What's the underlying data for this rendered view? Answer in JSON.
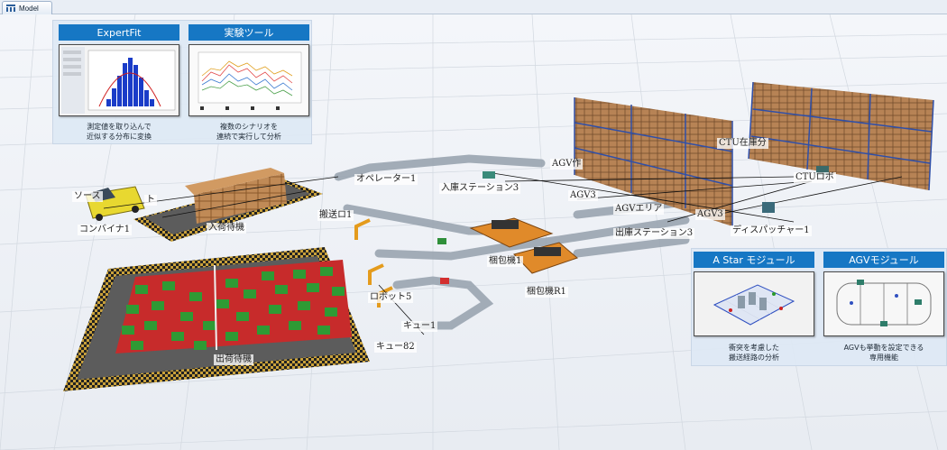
{
  "tab": {
    "label": "Model",
    "icon": "model-tree-icon"
  },
  "panels": {
    "expertfit": {
      "title": "ExpertFit",
      "caption": "測定値を取り込んで\n近似する分布に変換"
    },
    "experiment": {
      "title": "実験ツール",
      "caption": "複数のシナリオを\n連続で実行して分析"
    },
    "astar": {
      "title": "A Star モジュール",
      "caption": "衝突を考慮した\n搬送経路の分析"
    },
    "agv": {
      "title": "AGVモジュール",
      "caption": "AGVも挙動を設定できる\n専用機能"
    }
  },
  "labels": {
    "source": "ソース",
    "source_suffix": "ト",
    "combiner": "コンバイナ1",
    "inbound_wait": "入荷待機",
    "operator": "オペレーター1",
    "receiving_station": "入庫ステーション3",
    "agv_top": "AGV作",
    "agv3": "AGV3",
    "ctu_storage": "CTU在庫分",
    "ctu_robot": "CTUロボ",
    "agv_mid": "AGVエリア",
    "agv3_right": "AGV3",
    "dispatcher": "ディスパッチャー1",
    "shipping_station": "出庫ステーション3",
    "packer1": "梱包機1",
    "packer_r1": "梱包機R1",
    "robot1": "搬送ロ1",
    "robot_arm": "ロボット5",
    "queue1": "キュー1",
    "queue82": "キュー82",
    "outbound_wait": "出荷待機"
  },
  "colors": {
    "panel_header": "#1677c4",
    "red_box": "#e02a2a",
    "green_box": "#2e9a2e",
    "cardboard": "#b07a4a",
    "rack_blue": "#2f4fa8"
  }
}
